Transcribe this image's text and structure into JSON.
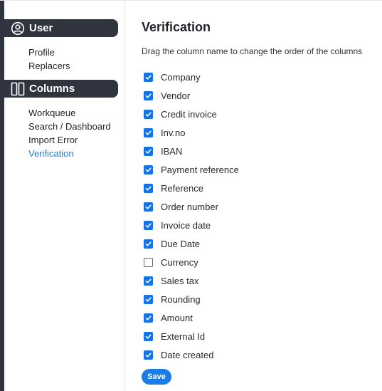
{
  "sidebar": {
    "user_section": {
      "label": "User",
      "icon": "user-circle-icon",
      "items": [
        {
          "label": "Profile",
          "active": false
        },
        {
          "label": "Replacers",
          "active": false
        }
      ]
    },
    "columns_section": {
      "label": "Columns",
      "icon": "columns-icon",
      "items": [
        {
          "label": "Workqueue",
          "active": false
        },
        {
          "label": "Search / Dashboard",
          "active": false
        },
        {
          "label": "Import Error",
          "active": false
        },
        {
          "label": "Verification",
          "active": true
        }
      ]
    }
  },
  "main": {
    "title": "Verification",
    "instructions": "Drag the column name to change the order of the columns",
    "columns": [
      {
        "label": "Company",
        "checked": true
      },
      {
        "label": "Vendor",
        "checked": true
      },
      {
        "label": "Credit invoice",
        "checked": true
      },
      {
        "label": "Inv.no",
        "checked": true
      },
      {
        "label": "IBAN",
        "checked": true
      },
      {
        "label": "Payment reference",
        "checked": true
      },
      {
        "label": "Reference",
        "checked": true
      },
      {
        "label": "Order number",
        "checked": true
      },
      {
        "label": "Invoice date",
        "checked": true
      },
      {
        "label": "Due Date",
        "checked": true
      },
      {
        "label": "Currency",
        "checked": false
      },
      {
        "label": "Sales tax",
        "checked": true
      },
      {
        "label": "Rounding",
        "checked": true
      },
      {
        "label": "Amount",
        "checked": true
      },
      {
        "label": "External Id",
        "checked": true
      },
      {
        "label": "Date created",
        "checked": true
      }
    ],
    "save_label": "Save"
  },
  "colors": {
    "sidebar_header_bg": "#2f343e",
    "accent": "#1473e6",
    "active_link": "#1e7fd8"
  }
}
